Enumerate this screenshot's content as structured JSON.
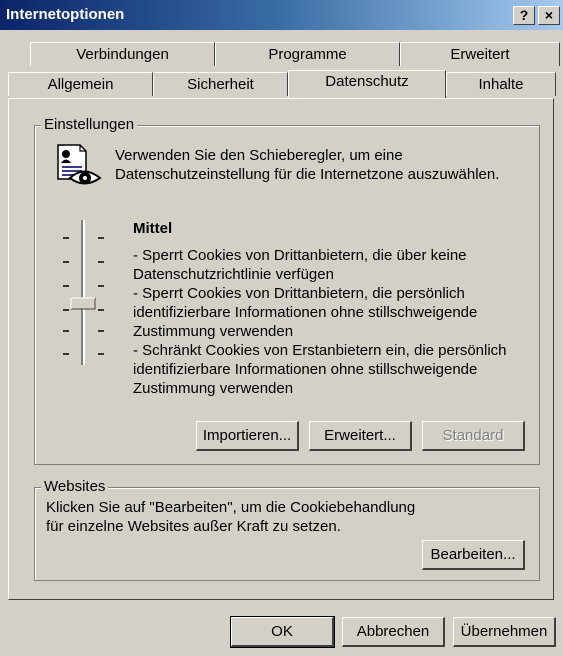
{
  "window": {
    "title": "Internetoptionen",
    "help_label": "?",
    "close_label": "×"
  },
  "tabs": {
    "row1": [
      "Verbindungen",
      "Programme",
      "Erweitert"
    ],
    "row2": [
      "Allgemein",
      "Sicherheit",
      "Datenschutz",
      "Inhalte"
    ],
    "active": "Datenschutz"
  },
  "settings": {
    "legend": "Einstellungen",
    "intro_line1": "Verwenden Sie den Schieberegler, um eine",
    "intro_line2": "Datenschutzeinstellung für die Internetzone auszuwählen.",
    "level_title": "Mittel",
    "slider_level": "3 of 6",
    "desc_lines": [
      "- Sperrt Cookies von Drittanbietern, die über keine",
      "Datenschutzrichtlinie verfügen",
      "- Sperrt Cookies von Drittanbietern, die persönlich",
      "identifizierbare Informationen ohne stillschweigende",
      "Zustimmung verwenden",
      "- Schränkt Cookies von Erstanbietern ein, die persönlich",
      "identifizierbare Informationen ohne stillschweigende",
      "Zustimmung verwenden"
    ],
    "buttons": {
      "import": "Importieren...",
      "advanced": "Erweitert...",
      "default": "Standard"
    }
  },
  "websites": {
    "legend": "Websites",
    "line1": "Klicken Sie auf \"Bearbeiten\", um die Cookiebehandlung",
    "line2": "für einzelne Websites außer Kraft zu setzen.",
    "edit_button": "Bearbeiten..."
  },
  "footer": {
    "ok": "OK",
    "cancel": "Abbrechen",
    "apply": "Übernehmen"
  }
}
